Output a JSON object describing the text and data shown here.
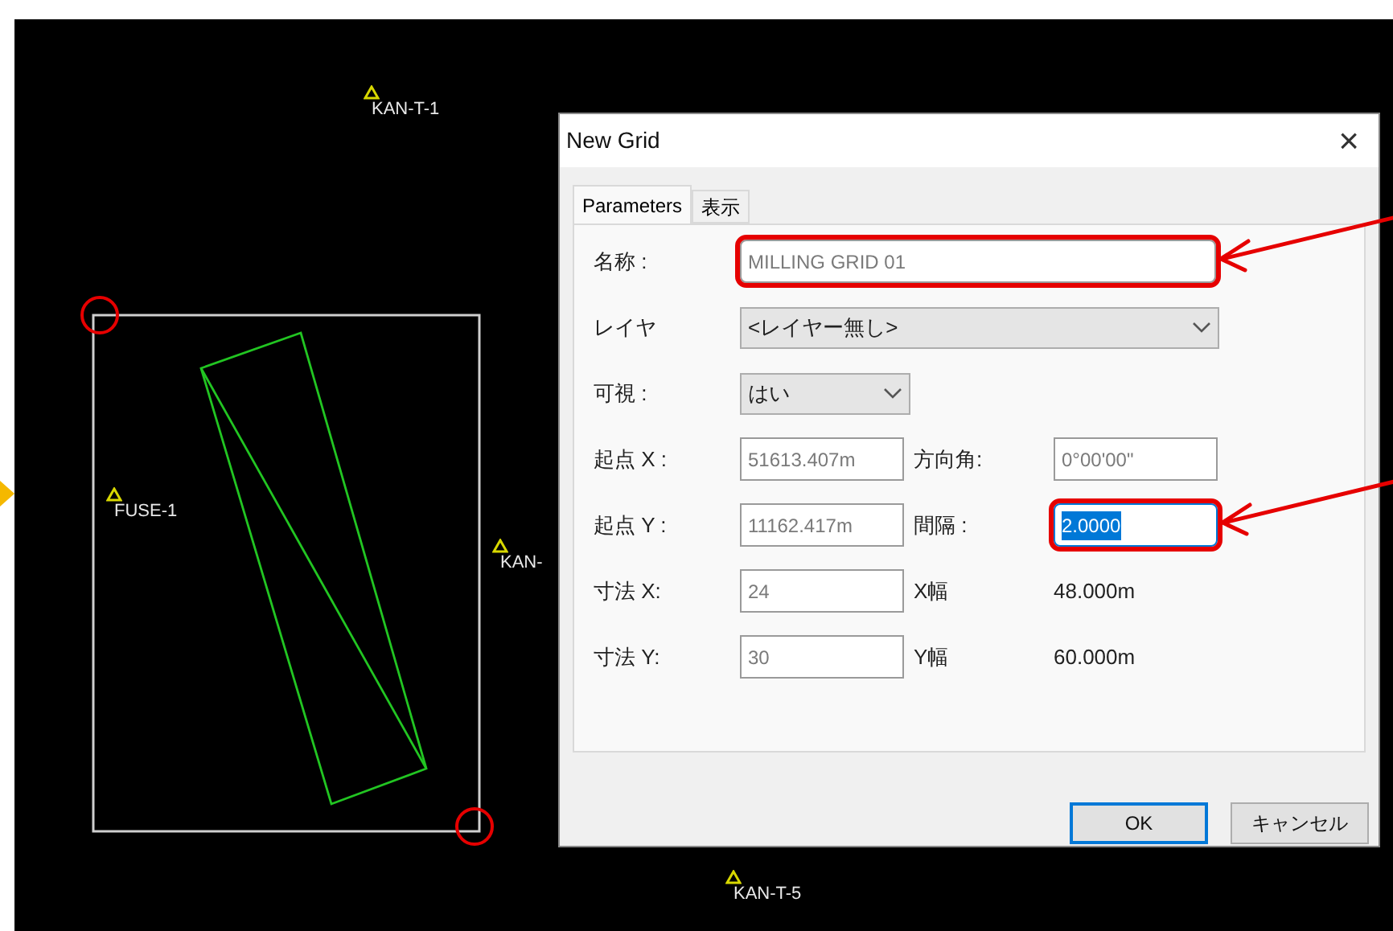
{
  "canvas": {
    "points": [
      {
        "label": "KAN-T-1"
      },
      {
        "label": "FUSE-1"
      },
      {
        "label": "KAN-"
      },
      {
        "label": "KAN-T-5"
      }
    ]
  },
  "dialog": {
    "title": "New Grid",
    "close": "×",
    "tabs": [
      {
        "label": "Parameters",
        "selected": true
      },
      {
        "label": "表示",
        "selected": false
      }
    ],
    "rows": [
      {
        "label": "名称 :",
        "field": {
          "kind": "text",
          "value": "MILLING GRID 01",
          "annotated": true,
          "focused": false
        }
      },
      {
        "label": "レイヤ",
        "field": {
          "kind": "combo",
          "value": "<レイヤー無し>"
        }
      },
      {
        "label": "可視 :",
        "field": {
          "kind": "dropdown",
          "value": "はい"
        }
      },
      {
        "label": "起点 X :",
        "field": {
          "kind": "text",
          "value": "51613.407m",
          "annotated": false,
          "focused": false
        },
        "side": {
          "label": "方向角:",
          "field": {
            "kind": "text",
            "value": "0°00'00\"",
            "annotated": false,
            "focused": false
          }
        }
      },
      {
        "label": "起点 Y :",
        "field": {
          "kind": "text",
          "value": "11162.417m",
          "annotated": false,
          "focused": false
        },
        "side": {
          "label": "間隔 :",
          "field": {
            "kind": "text",
            "value": "2.0000",
            "annotated": true,
            "focused": true
          }
        }
      },
      {
        "label": "寸法 X:",
        "field": {
          "kind": "text",
          "value": "24",
          "annotated": false,
          "focused": false
        },
        "side": {
          "label": "X幅",
          "field": {
            "kind": "readout",
            "value": "48.000m"
          }
        }
      },
      {
        "label": "寸法 Y:",
        "field": {
          "kind": "text",
          "value": "30",
          "annotated": false,
          "focused": false
        },
        "side": {
          "label": "Y幅",
          "field": {
            "kind": "readout",
            "value": "60.000m"
          }
        }
      }
    ],
    "buttons": [
      {
        "label": "OK",
        "default": true
      },
      {
        "label": "キャンセル",
        "default": false
      }
    ]
  }
}
